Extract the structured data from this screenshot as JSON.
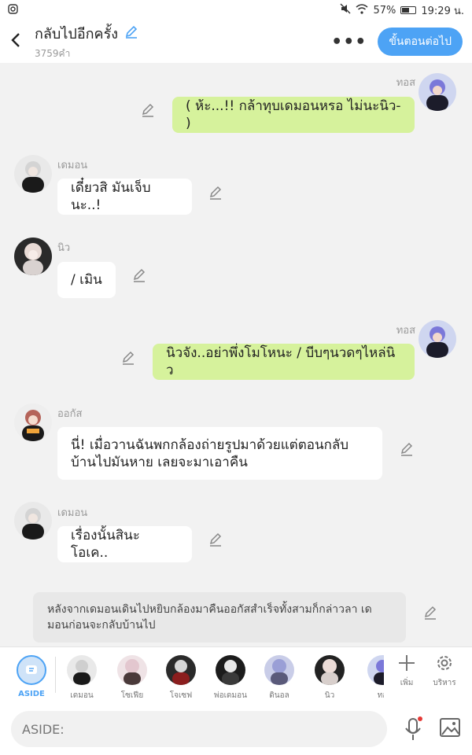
{
  "status": {
    "battery": "57%",
    "time": "19:29 น."
  },
  "header": {
    "title": "กลับไปอีกครั้ง",
    "word_count": "3759คำ",
    "next_label": "ขั้นตอนต่อไป",
    "more_icon": "more-dots-icon"
  },
  "messages": [
    {
      "side": "right",
      "name": "ทอส",
      "text": "( ห้ะ...!! กล้าทุบเดมอนหรอ ไม่นะนิว- )"
    },
    {
      "side": "left",
      "name": "เดมอน",
      "text": "เดี๋ยวสิ มันเจ็บนะ..!"
    },
    {
      "side": "left",
      "name": "นิว",
      "text": "/ เมิน"
    },
    {
      "side": "right",
      "name": "ทอส",
      "text": "นิวจัง..อย่าพึ่งโมโหนะ / บีบๆนวดๆไหล่นิว"
    },
    {
      "side": "left",
      "name": "ออกัส",
      "text": "นี่! เมื่อวานฉันพกกล้องถ่ายรูปมาด้วยแต่ตอนกลับ บ้านไปมันหาย เลยจะมาเอาคืน"
    },
    {
      "side": "left",
      "name": "เดมอน",
      "text": "เรื่องนั้นสินะ โอเค.."
    }
  ],
  "aside_note": "หลังจากเดมอนเดินไปหยิบกล้องมาคืนออกัสสำเร็จทั้งสามก็กล่าวลา เดมอนก่อนจะกลับบ้านไป",
  "cast": {
    "aside_label": "ASIDE",
    "members": [
      "เดมอน",
      "โซเฟีย",
      "โจเซฟ",
      "พ่อเดมอน",
      "ดินอล",
      "นิว",
      "ทอ"
    ],
    "add_label": "เพิ่ม",
    "manage_label": "บริหาร"
  },
  "input": {
    "placeholder": "ASIDE:"
  },
  "colors": {
    "accent": "#4da3f5",
    "right_bubble": "#d6f29c",
    "left_bubble": "#ffffff"
  }
}
